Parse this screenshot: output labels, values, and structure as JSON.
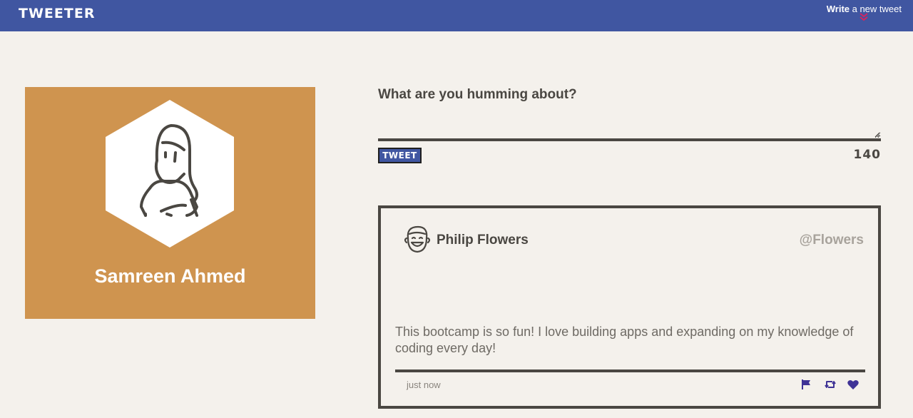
{
  "nav": {
    "logo": "TWEETER",
    "write_bold": "Write",
    "write_rest": " a new tweet",
    "chevron_icon": "double-chevron-down-icon",
    "chevron_color": "#d6245f"
  },
  "profile": {
    "name": "Samreen Ahmed",
    "avatar_icon": "woman-avatar-icon",
    "background_color": "#cf944f"
  },
  "composer": {
    "label": "What are you humming about?",
    "value": "",
    "placeholder": "",
    "button_label": "TWEET",
    "counter": "140"
  },
  "tweets": [
    {
      "name": "Philip Flowers",
      "handle": "@Flowers",
      "content": "This bootcamp is so fun! I love building apps and expanding on my knowledge of coding every day!",
      "time": "just now",
      "avatar_icon": "laughing-man-avatar-icon",
      "actions": [
        "flag-icon",
        "retweet-icon",
        "heart-icon"
      ]
    }
  ],
  "colors": {
    "navbar": "#4056a1",
    "background": "#f4f1ec",
    "text": "#4a4742",
    "action_icons": "#3f3396"
  }
}
